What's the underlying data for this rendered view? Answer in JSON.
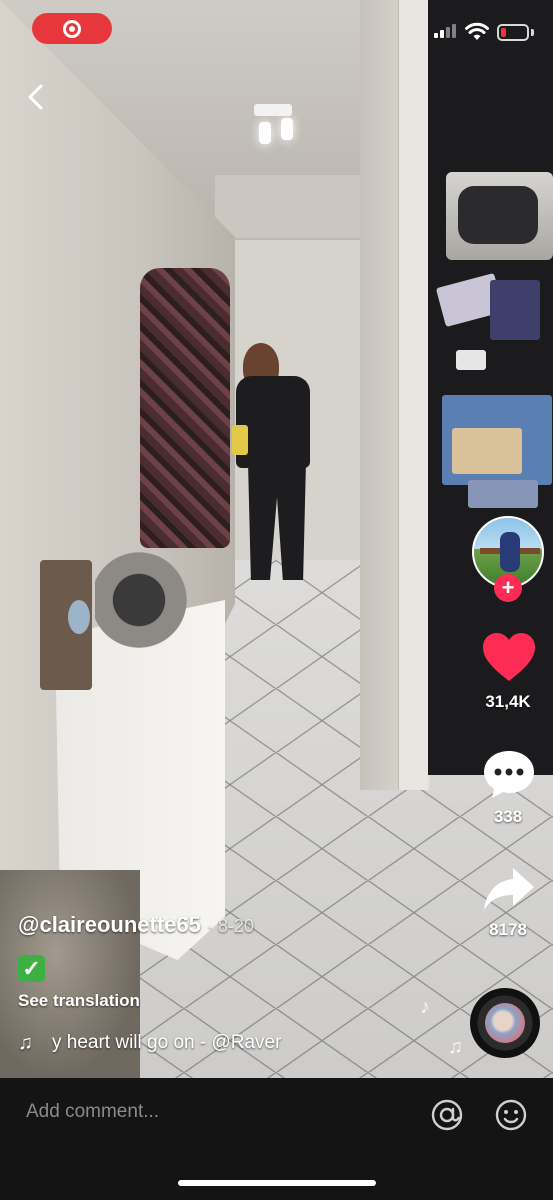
{
  "status_bar": {
    "recording_icon": "screen-record-icon",
    "signal_icon": "cellular-signal-icon",
    "wifi_icon": "wifi-icon",
    "battery_icon": "battery-low-icon",
    "battery_color": "#e8373c"
  },
  "nav": {
    "back_icon": "chevron-left-icon"
  },
  "actions": {
    "like_count": "31,4K",
    "comment_count": "338",
    "share_count": "8178",
    "follow_symbol": "+",
    "like_color": "#fe2c55"
  },
  "post": {
    "username": "@claireounette65",
    "date": "· 8-20",
    "caption_emoji": "✓",
    "see_translation": "See translation",
    "sound_title": "y heart will go on - @Raver"
  },
  "comment_bar": {
    "placeholder": "Add comment...",
    "mention_icon": "at-icon",
    "emoji_icon": "smiley-icon"
  }
}
